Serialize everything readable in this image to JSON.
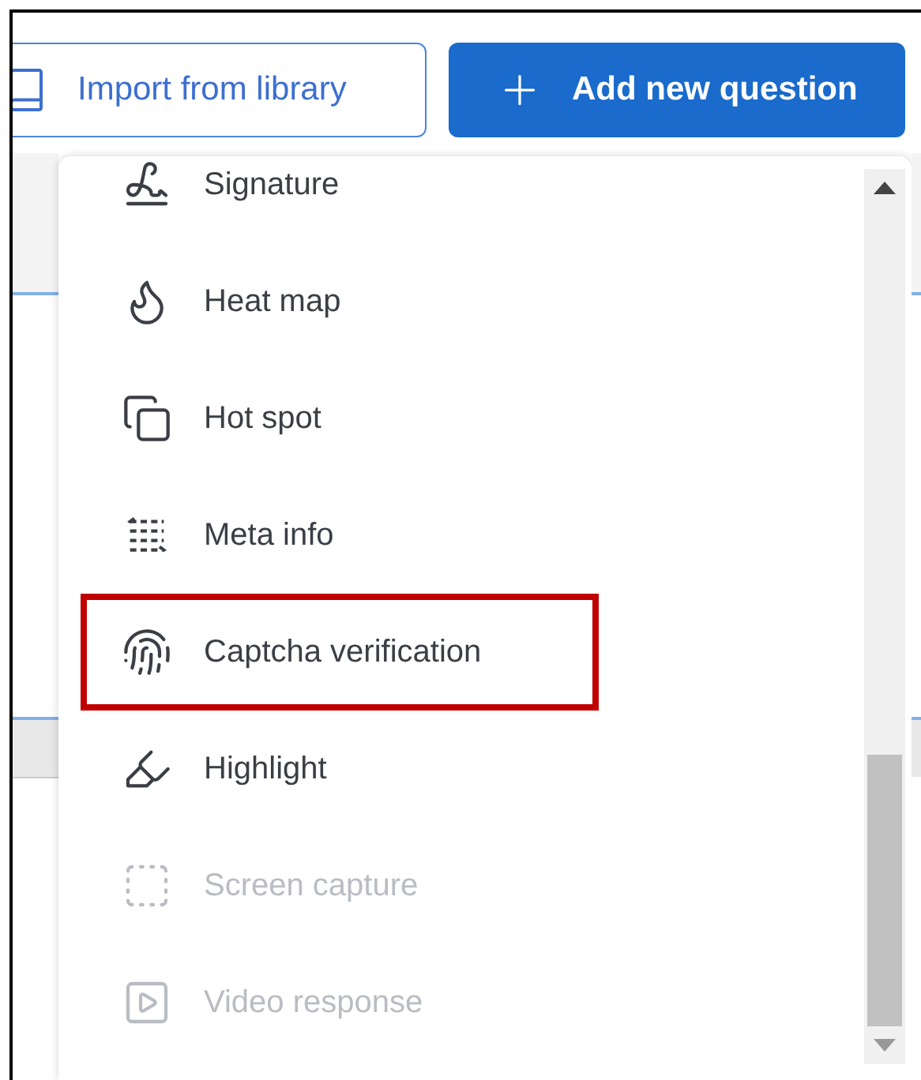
{
  "toolbar": {
    "buttons": [
      {
        "label": "Import from library",
        "kind": "outline"
      },
      {
        "label": "Add new question",
        "kind": "primary"
      }
    ]
  },
  "menu": {
    "items": [
      {
        "label": "Signature",
        "disabled": false,
        "highlighted": false
      },
      {
        "label": "Heat map",
        "disabled": false,
        "highlighted": false
      },
      {
        "label": "Hot spot",
        "disabled": false,
        "highlighted": false
      },
      {
        "label": "Meta info",
        "disabled": false,
        "highlighted": false
      },
      {
        "label": "Captcha verification",
        "disabled": false,
        "highlighted": true
      },
      {
        "label": "Highlight",
        "disabled": false,
        "highlighted": false
      },
      {
        "label": "Screen capture",
        "disabled": true,
        "highlighted": false
      },
      {
        "label": "Video response",
        "disabled": true,
        "highlighted": false
      }
    ]
  }
}
